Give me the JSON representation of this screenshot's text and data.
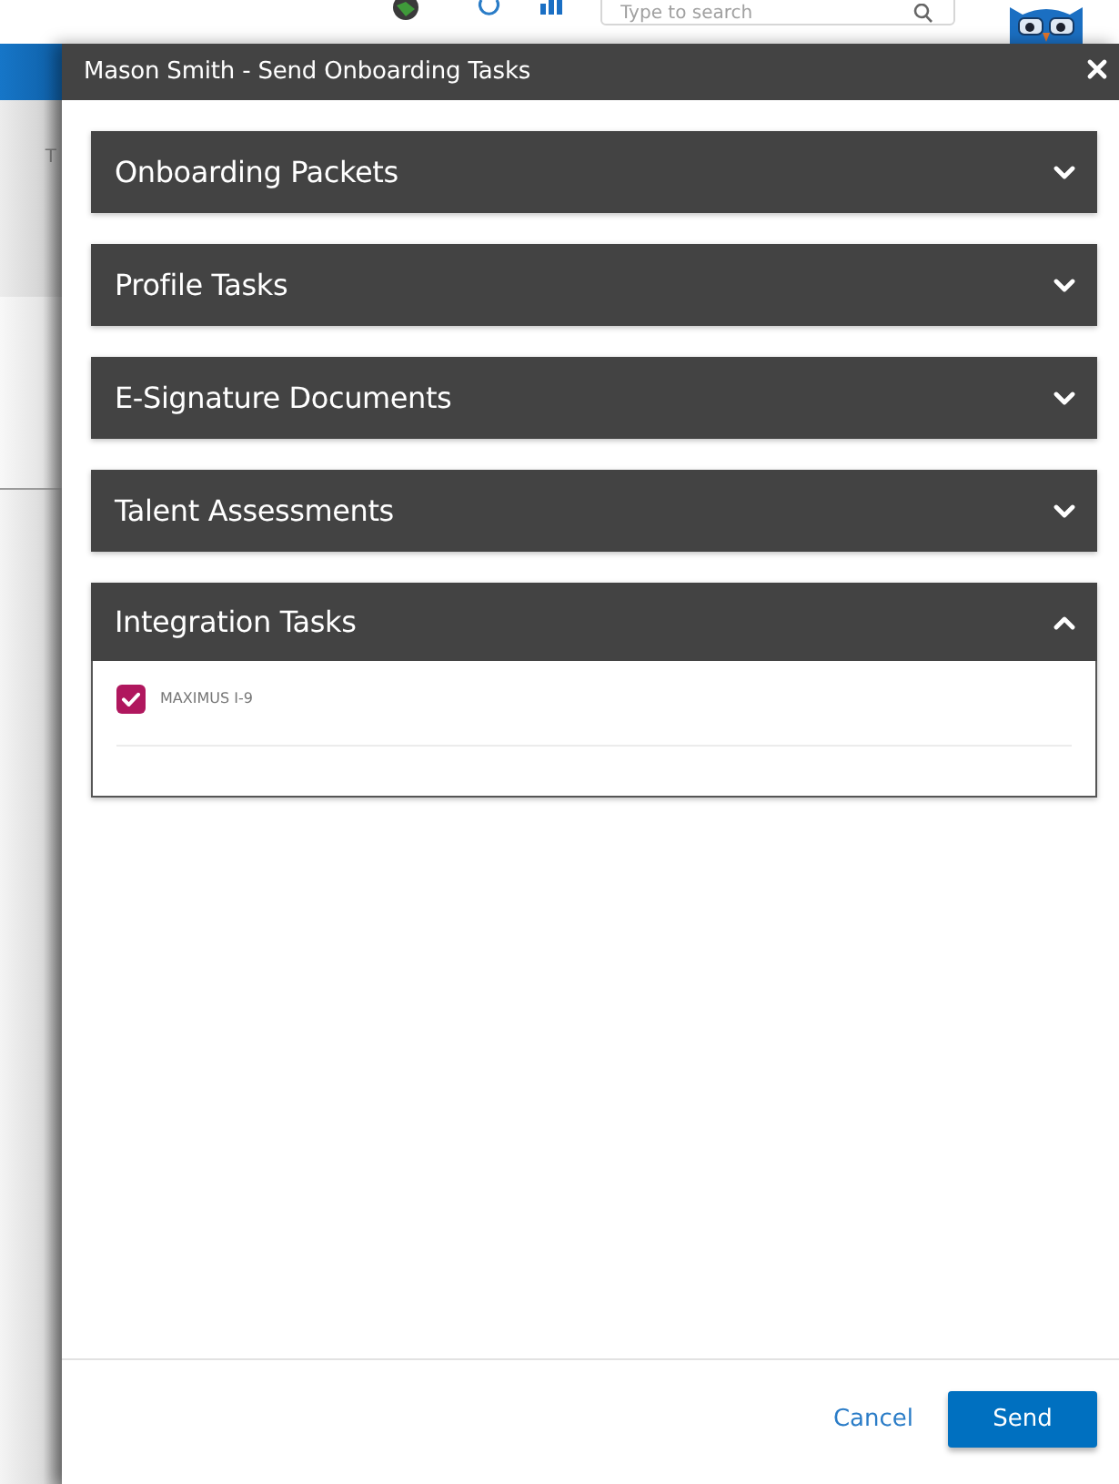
{
  "top_bar": {
    "search": {
      "placeholder": "Type to search"
    }
  },
  "backdrop": {
    "text": "T"
  },
  "dialog": {
    "title": "Mason Smith - Send Onboarding Tasks"
  },
  "sections": [
    {
      "title": "Onboarding Packets",
      "expanded": false
    },
    {
      "title": "Profile Tasks",
      "expanded": false
    },
    {
      "title": "E-Signature Documents",
      "expanded": false
    },
    {
      "title": "Talent Assessments",
      "expanded": false
    },
    {
      "title": "Integration Tasks",
      "expanded": true,
      "items": [
        {
          "label": "MAXIMUS I-9",
          "checked": true
        }
      ]
    }
  ],
  "footer": {
    "buttons": [
      {
        "label": "Cancel",
        "kind": "link"
      },
      {
        "label": "Send",
        "kind": "primary"
      }
    ]
  }
}
